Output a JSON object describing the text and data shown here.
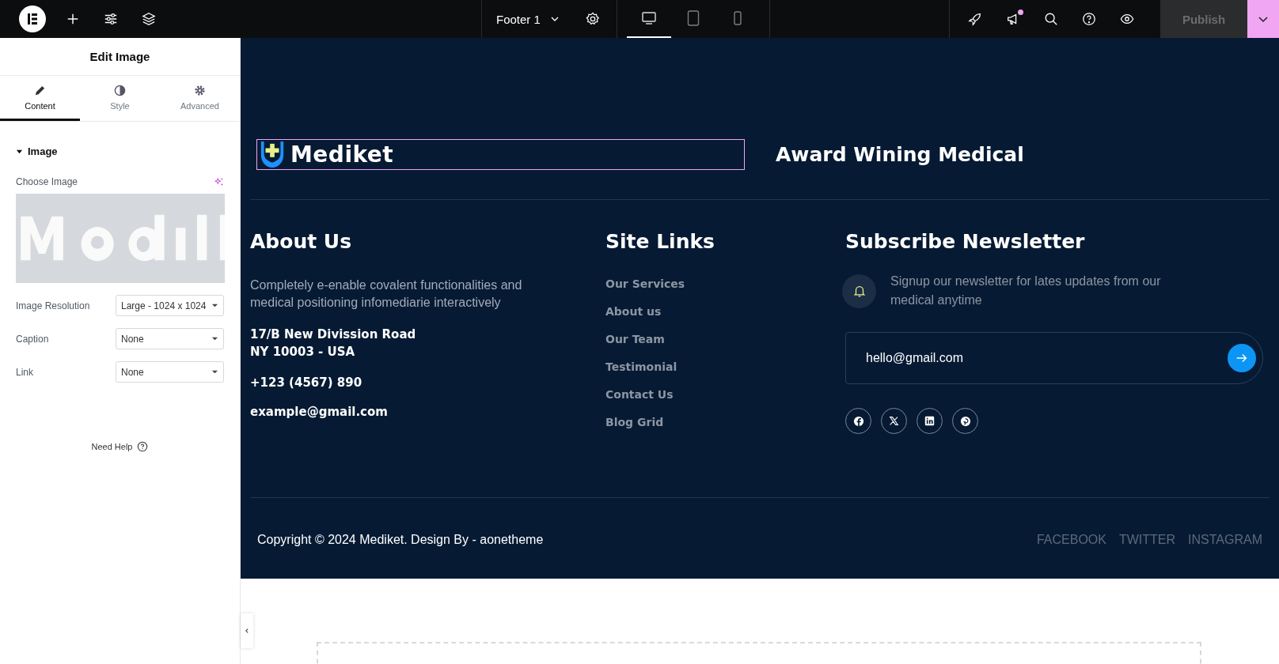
{
  "topbar": {
    "document": "Footer 1",
    "devices": [
      {
        "kind": "desktop",
        "selected": true
      },
      {
        "kind": "tablet",
        "selected": false
      },
      {
        "kind": "mobile",
        "selected": false
      }
    ],
    "notifications_unread": true,
    "publish": {
      "label": "Publish",
      "disabled": true
    }
  },
  "panel": {
    "title": "Edit Image",
    "tabs": [
      {
        "kind": "content",
        "label": "Content",
        "selected": true
      },
      {
        "kind": "style",
        "label": "Style",
        "selected": false
      },
      {
        "kind": "advanced",
        "label": "Advanced",
        "selected": false
      }
    ],
    "section": {
      "title": "Image",
      "expanded": true
    },
    "choose_image_label": "Choose Image",
    "fields": [
      {
        "label": "Image Resolution",
        "value": "Large - 1024 x 1024"
      },
      {
        "label": "Caption",
        "value": "None"
      },
      {
        "label": "Link",
        "value": "None"
      }
    ],
    "help": "Need Help"
  },
  "footer": {
    "logo": {
      "text": "Mediket",
      "selected": true
    },
    "tagline": "Award Wining Medical",
    "about": {
      "heading": "About Us",
      "text": "Completely e-enable covalent functionalities and medical positioning infomediarie interactively",
      "address_lines": [
        "17/B New Divission Road",
        "NY 10003 - USA"
      ],
      "phone": "+123 (4567) 890",
      "email": "example@gmail.com"
    },
    "site_links": {
      "heading": "Site Links",
      "links": [
        "Our Services",
        "About us",
        "Our Team",
        "Testimonial",
        "Contact Us",
        "Blog Grid"
      ]
    },
    "newsletter": {
      "heading": "Subscribe Newsletter",
      "text": "Signup our newsletter for lates updates from our medical anytime",
      "email_value": "hello@gmail.com"
    },
    "copyright": "Copyright © 2024 Mediket. Design By - aonetheme",
    "bottom_links": [
      "FACEBOOK",
      "TWITTER",
      "INSTAGRAM"
    ]
  }
}
